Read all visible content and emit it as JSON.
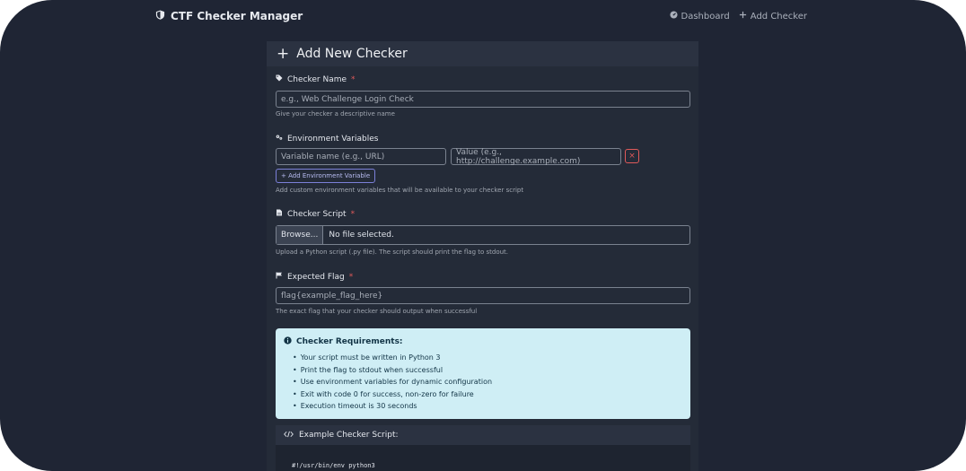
{
  "navbar": {
    "brand": "CTF Checker Manager",
    "links": [
      {
        "label": "Dashboard",
        "icon": "gauge-icon"
      },
      {
        "label": "Add Checker",
        "icon": "plus-icon"
      }
    ]
  },
  "card": {
    "title": "Add New Checker",
    "checker_name": {
      "label": "Checker Name",
      "required_mark": "*",
      "placeholder": "e.g., Web Challenge Login Check",
      "help": "Give your checker a descriptive name"
    },
    "env_vars": {
      "label": "Environment Variables",
      "name_placeholder": "Variable name (e.g., URL)",
      "value_placeholder": "Value (e.g., http://challenge.example.com)",
      "remove_label": "×",
      "add_label": "+ Add Environment Variable",
      "help": "Add custom environment variables that will be available to your checker script"
    },
    "script": {
      "label": "Checker Script",
      "required_mark": "*",
      "browse_label": "Browse...",
      "file_status": "No file selected.",
      "help": "Upload a Python script (.py file). The script should print the flag to stdout."
    },
    "flag": {
      "label": "Expected Flag",
      "required_mark": "*",
      "placeholder": "flag{example_flag_here}",
      "help": "The exact flag that your checker should output when successful"
    },
    "requirements": {
      "title": "Checker Requirements:",
      "items": [
        "Your script must be written in Python 3",
        "Print the flag to stdout when successful",
        "Use environment variables for dynamic configuration",
        "Exit with code 0 for success, non-zero for failure",
        "Execution timeout is 30 seconds"
      ]
    },
    "example": {
      "title": "Example Checker Script:",
      "code_first_line": "#!/usr/bin/env python3"
    }
  },
  "colors": {
    "background": "#1f2534",
    "card": "#242b38",
    "info_bg": "#cfeef5",
    "danger": "#e05a5a",
    "accent": "#7b80d9"
  }
}
